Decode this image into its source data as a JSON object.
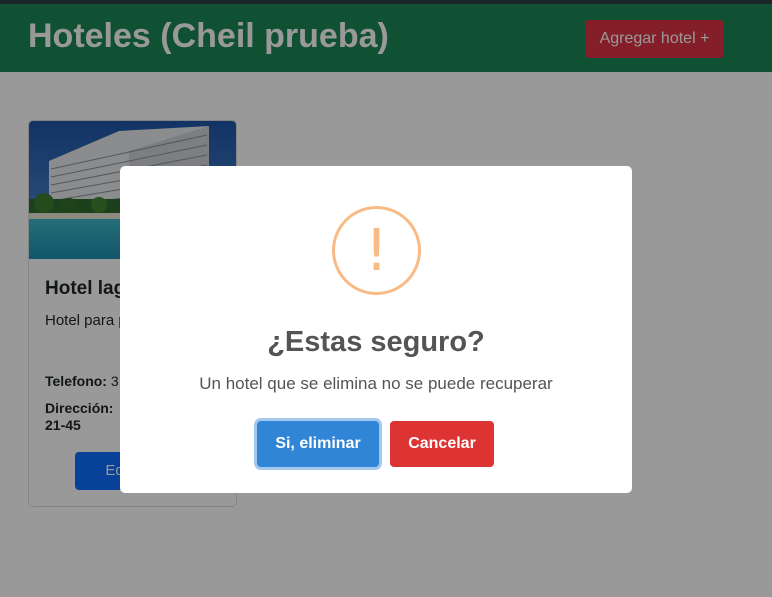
{
  "navbar": {
    "title": "Hoteles (Cheil prueba)",
    "add_button": "Agregar hotel +"
  },
  "card": {
    "title": "Hotel lag",
    "description": "Hotel para prueba",
    "phone_label": "Telefono:",
    "phone_value": "3",
    "address_label": "Dirección:",
    "address_value": "21-45",
    "edit_button": "Editar"
  },
  "modal": {
    "icon_text": "!",
    "icon": "warning-icon",
    "title": "¿Estas seguro?",
    "text": "Un hotel que se elimina no se puede recuperar",
    "confirm_button": "Si, eliminar",
    "cancel_button": "Cancelar"
  },
  "colors": {
    "navbar": "#198754",
    "danger": "#dc3545",
    "primary": "#0d6efd",
    "confirm": "#3085d6",
    "cancel": "#dd3333",
    "warning_icon": "#f8bb86"
  }
}
